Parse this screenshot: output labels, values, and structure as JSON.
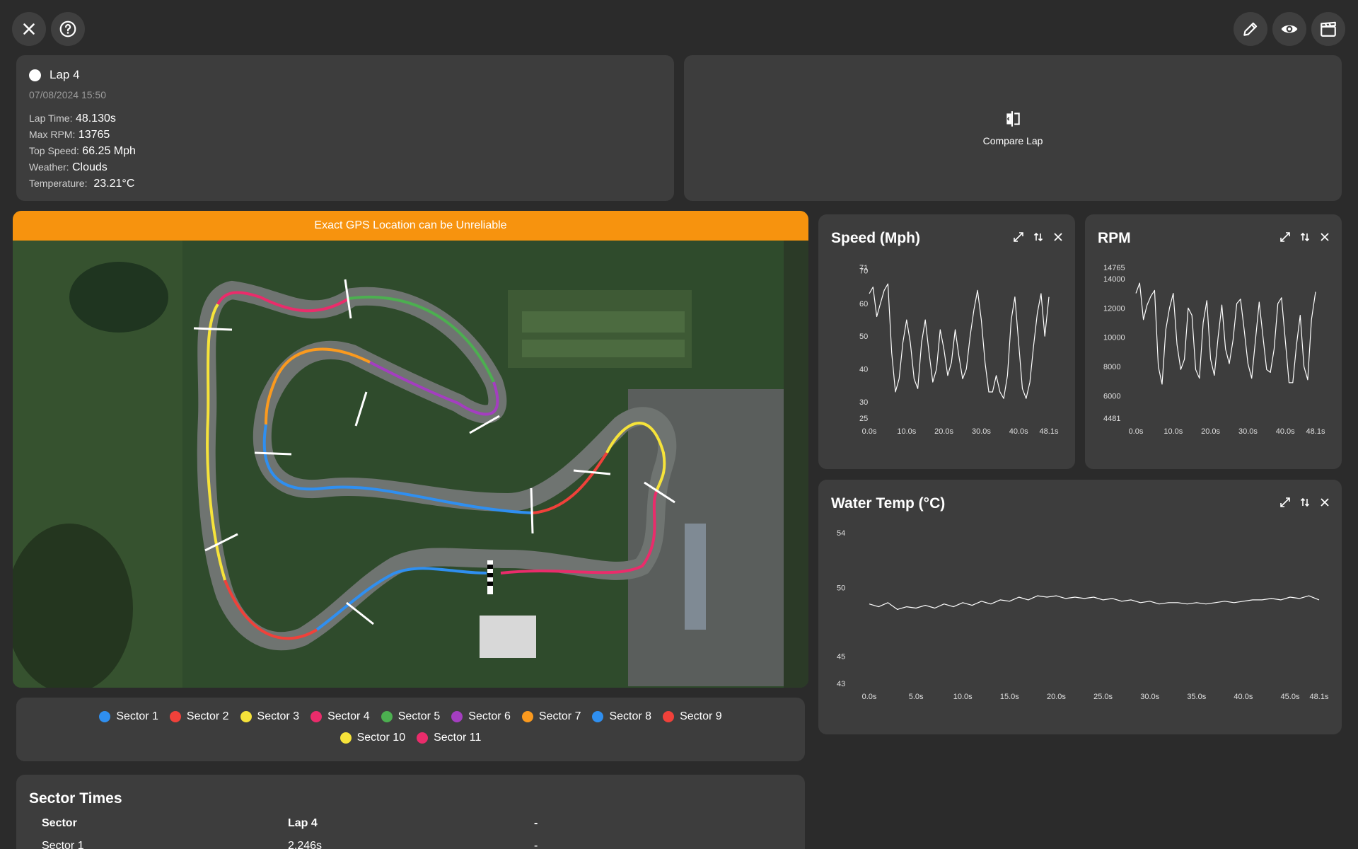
{
  "toolbar": {
    "close_icon": "close-icon",
    "help_icon": "help-icon",
    "edit_icon": "pencil-icon",
    "view_icon": "eye-icon",
    "video_icon": "clapperboard-icon"
  },
  "lap": {
    "title": "Lap 4",
    "date": "07/08/2024 15:50",
    "stats": [
      {
        "label": "Lap Time:",
        "value": "48.130s"
      },
      {
        "label": "Max RPM:",
        "value": "13765"
      },
      {
        "label": "Top Speed:",
        "value": "66.25 Mph"
      },
      {
        "label": "Weather:",
        "value": "Clouds"
      },
      {
        "label": "Temperature:",
        "value": "23.21°C"
      }
    ]
  },
  "compare": {
    "label": "Compare Lap"
  },
  "map": {
    "banner": "Exact GPS Location can be Unreliable"
  },
  "legend": {
    "rows": [
      [
        {
          "label": "Sector 1",
          "color": "#2f8ff0"
        },
        {
          "label": "Sector 2",
          "color": "#f0413a"
        },
        {
          "label": "Sector 3",
          "color": "#f6e33a"
        },
        {
          "label": "Sector 4",
          "color": "#ea2c6b"
        },
        {
          "label": "Sector 5",
          "color": "#4caf50"
        },
        {
          "label": "Sector 6",
          "color": "#a43ec0"
        },
        {
          "label": "Sector 7",
          "color": "#fb9a1e"
        },
        {
          "label": "Sector 8",
          "color": "#2f8ff0"
        },
        {
          "label": "Sector 9",
          "color": "#f0413a"
        }
      ],
      [
        {
          "label": "Sector 10",
          "color": "#f6e33a"
        },
        {
          "label": "Sector 11",
          "color": "#ea2c6b"
        }
      ]
    ]
  },
  "sector_times": {
    "title": "Sector Times",
    "headers": [
      "Sector",
      "Lap 4",
      "-"
    ],
    "rows": [
      [
        "Sector 1",
        "2.246s",
        "-"
      ]
    ]
  },
  "chart_data": [
    {
      "type": "line",
      "title": "Speed (Mph)",
      "yticks": [
        "71",
        "70",
        "60",
        "50",
        "40",
        "30",
        "25"
      ],
      "xticks": [
        "0.0s",
        "10.0s",
        "20.0s",
        "30.0s",
        "40.0s",
        "48.1s"
      ],
      "ylim": [
        25,
        71
      ],
      "xlim": [
        0,
        48.1
      ],
      "series": [
        {
          "x": [
            0,
            1,
            2,
            3,
            4,
            5,
            6,
            7,
            8,
            9,
            10,
            11,
            12,
            13,
            14,
            15,
            16,
            17,
            18,
            19,
            20,
            21,
            22,
            23,
            24,
            25,
            26,
            27,
            28,
            29,
            30,
            31,
            32,
            33,
            34,
            35,
            36,
            37,
            38,
            39,
            40,
            41,
            42,
            43,
            44,
            45,
            46,
            47,
            48.1
          ],
          "values": [
            63,
            65,
            56,
            60,
            64,
            66,
            45,
            33,
            37,
            48,
            55,
            48,
            37,
            34,
            48,
            55,
            45,
            36,
            40,
            52,
            46,
            38,
            42,
            52,
            44,
            37,
            40,
            50,
            58,
            64,
            55,
            42,
            33,
            33,
            38,
            33,
            31,
            38,
            55,
            62,
            48,
            34,
            31,
            36,
            47,
            57,
            63,
            50,
            62
          ]
        }
      ]
    },
    {
      "type": "line",
      "title": "RPM",
      "yticks": [
        "14765",
        "14000",
        "12000",
        "10000",
        "8000",
        "6000",
        "4481"
      ],
      "xticks": [
        "0.0s",
        "10.0s",
        "20.0s",
        "30.0s",
        "40.0s",
        "48.1s"
      ],
      "ylim": [
        4481,
        14765
      ],
      "xlim": [
        0,
        48.1
      ],
      "series": [
        {
          "x": [
            0,
            1,
            2,
            3,
            4,
            5,
            6,
            7,
            8,
            9,
            10,
            11,
            12,
            13,
            14,
            15,
            16,
            17,
            18,
            19,
            20,
            21,
            22,
            23,
            24,
            25,
            26,
            27,
            28,
            29,
            30,
            31,
            32,
            33,
            34,
            35,
            36,
            37,
            38,
            39,
            40,
            41,
            42,
            43,
            44,
            45,
            46,
            47,
            48.1
          ],
          "values": [
            13000,
            13700,
            11200,
            12200,
            12800,
            13200,
            8000,
            6800,
            10500,
            12000,
            13000,
            9500,
            7800,
            8500,
            12000,
            11500,
            7800,
            7200,
            11000,
            12500,
            8500,
            7400,
            10000,
            12200,
            9200,
            8200,
            9800,
            12300,
            12600,
            10500,
            8200,
            7200,
            9800,
            12400,
            10100,
            7800,
            7600,
            9200,
            12300,
            12700,
            9800,
            6900,
            6900,
            9500,
            11500,
            8000,
            7100,
            11200,
            13100
          ]
        }
      ]
    },
    {
      "type": "line",
      "title": "Water Temp (°C)",
      "yticks": [
        "54",
        "50",
        "45",
        "43"
      ],
      "xticks": [
        "0.0s",
        "5.0s",
        "10.0s",
        "15.0s",
        "20.0s",
        "25.0s",
        "30.0s",
        "35.0s",
        "40.0s",
        "45.0s",
        "48.1s"
      ],
      "ylim": [
        43,
        54
      ],
      "xlim": [
        0,
        48.1
      ],
      "series": [
        {
          "x": [
            0,
            1,
            2,
            3,
            4,
            5,
            6,
            7,
            8,
            9,
            10,
            11,
            12,
            13,
            14,
            15,
            16,
            17,
            18,
            19,
            20,
            21,
            22,
            23,
            24,
            25,
            26,
            27,
            28,
            29,
            30,
            31,
            32,
            33,
            34,
            35,
            36,
            37,
            38,
            39,
            40,
            41,
            42,
            43,
            44,
            45,
            46,
            47,
            48.1
          ],
          "values": [
            48.8,
            48.6,
            48.9,
            48.4,
            48.6,
            48.5,
            48.7,
            48.5,
            48.8,
            48.6,
            48.9,
            48.7,
            49.0,
            48.8,
            49.1,
            49.0,
            49.3,
            49.1,
            49.4,
            49.3,
            49.4,
            49.2,
            49.3,
            49.2,
            49.3,
            49.1,
            49.2,
            49.0,
            49.1,
            48.9,
            49.0,
            48.8,
            48.9,
            48.9,
            48.8,
            48.9,
            48.8,
            48.9,
            49.0,
            48.9,
            49.0,
            49.1,
            49.1,
            49.2,
            49.1,
            49.3,
            49.2,
            49.4,
            49.1
          ]
        }
      ]
    }
  ]
}
